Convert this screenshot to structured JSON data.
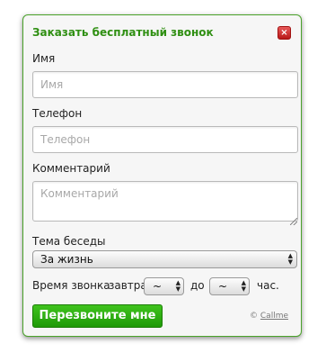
{
  "dialog": {
    "title": "Заказать бесплатный звонок",
    "close_label": "×"
  },
  "form": {
    "name": {
      "label": "Имя",
      "placeholder": "Имя",
      "value": ""
    },
    "phone": {
      "label": "Телефон",
      "placeholder": "Телефон",
      "value": ""
    },
    "comment": {
      "label": "Комментарий",
      "placeholder": "Комментарий",
      "value": ""
    },
    "topic": {
      "label": "Тема беседы",
      "selected": "За жизнь"
    },
    "call_time": {
      "label": "Время звонка",
      "day": "завтра",
      "from_label": "до",
      "from_value": "~",
      "to_value": "~",
      "unit": "час."
    }
  },
  "submit_label": "Перезвоните мне",
  "brand": {
    "symbol": "©",
    "name": "Callme"
  },
  "colors": {
    "accent": "#2f8f12",
    "button": "#2aab10",
    "close": "#c82020",
    "panel_border": "#4aa22a"
  },
  "icons": {
    "close": "close-icon",
    "select_arrows": "updown-arrows-icon"
  }
}
